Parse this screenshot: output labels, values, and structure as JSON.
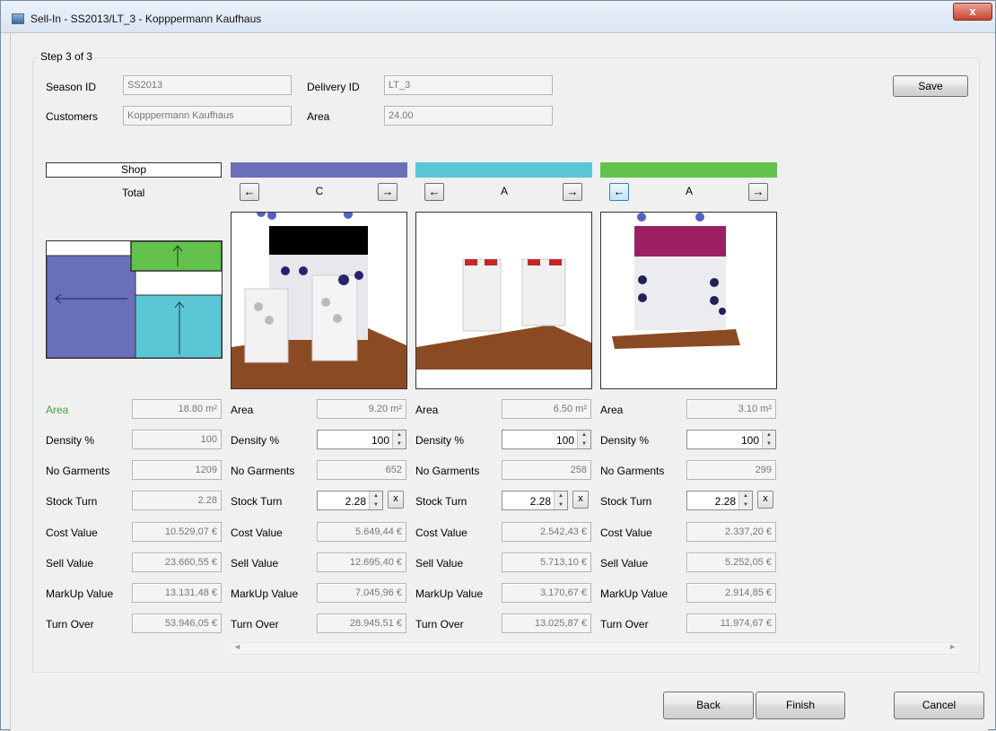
{
  "window": {
    "title": "Sell-In - SS2013/LT_3 - Kopppermann Kaufhaus",
    "close_label": "x"
  },
  "step": "Step 3 of 3",
  "header": {
    "season_label": "Season ID",
    "season_value": "SS2013",
    "delivery_label": "Delivery ID",
    "delivery_value": "LT_3",
    "customers_label": "Customers",
    "customers_value": "Kopppermann Kaufhaus",
    "area_label": "Area",
    "area_value": "24.00"
  },
  "buttons": {
    "save": "Save",
    "back": "Back",
    "finish": "Finish",
    "cancel": "Cancel"
  },
  "shop": {
    "header": "Shop",
    "sublabel": "Total"
  },
  "nav": {
    "left_arrow": "←",
    "right_arrow": "→"
  },
  "colors": {
    "col1": "#6a6fb9",
    "col2": "#5bc6d6",
    "col3": "#62c24b"
  },
  "row_labels": [
    "Area",
    "Density %",
    "No Garments",
    "Stock Turn",
    "Cost Value",
    "Sell Value",
    "MarkUp Value",
    "Turn Over"
  ],
  "total": {
    "area": "18.80 m²",
    "density": "100",
    "garments": "1209",
    "stock_turn": "2.28",
    "cost": "10.529,07 €",
    "sell": "23.660,55 €",
    "markup": "13.131,48 €",
    "turnover": "53.946,05 €"
  },
  "modules": [
    {
      "label": "C",
      "area": "9.20 m²",
      "density": "100",
      "garments": "652",
      "stock_turn": "2.28",
      "cost": "5.649,44 €",
      "sell": "12.695,40 €",
      "markup": "7.045,96 €",
      "turnover": "28.945,51 €"
    },
    {
      "label": "A",
      "area": "6.50 m²",
      "density": "100",
      "garments": "258",
      "stock_turn": "2.28",
      "cost": "2.542,43 €",
      "sell": "5.713,10 €",
      "markup": "3.170,67 €",
      "turnover": "13.025,87 €"
    },
    {
      "label": "A",
      "area": "3.10 m²",
      "density": "100",
      "garments": "299",
      "stock_turn": "2.28",
      "cost": "2.337,20 €",
      "sell": "5.252,05 €",
      "markup": "2.914,85 €",
      "turnover": "11.974,67 €"
    }
  ],
  "stock_turn_clear": "x",
  "scroll": {
    "left": "◄",
    "right": "►"
  }
}
